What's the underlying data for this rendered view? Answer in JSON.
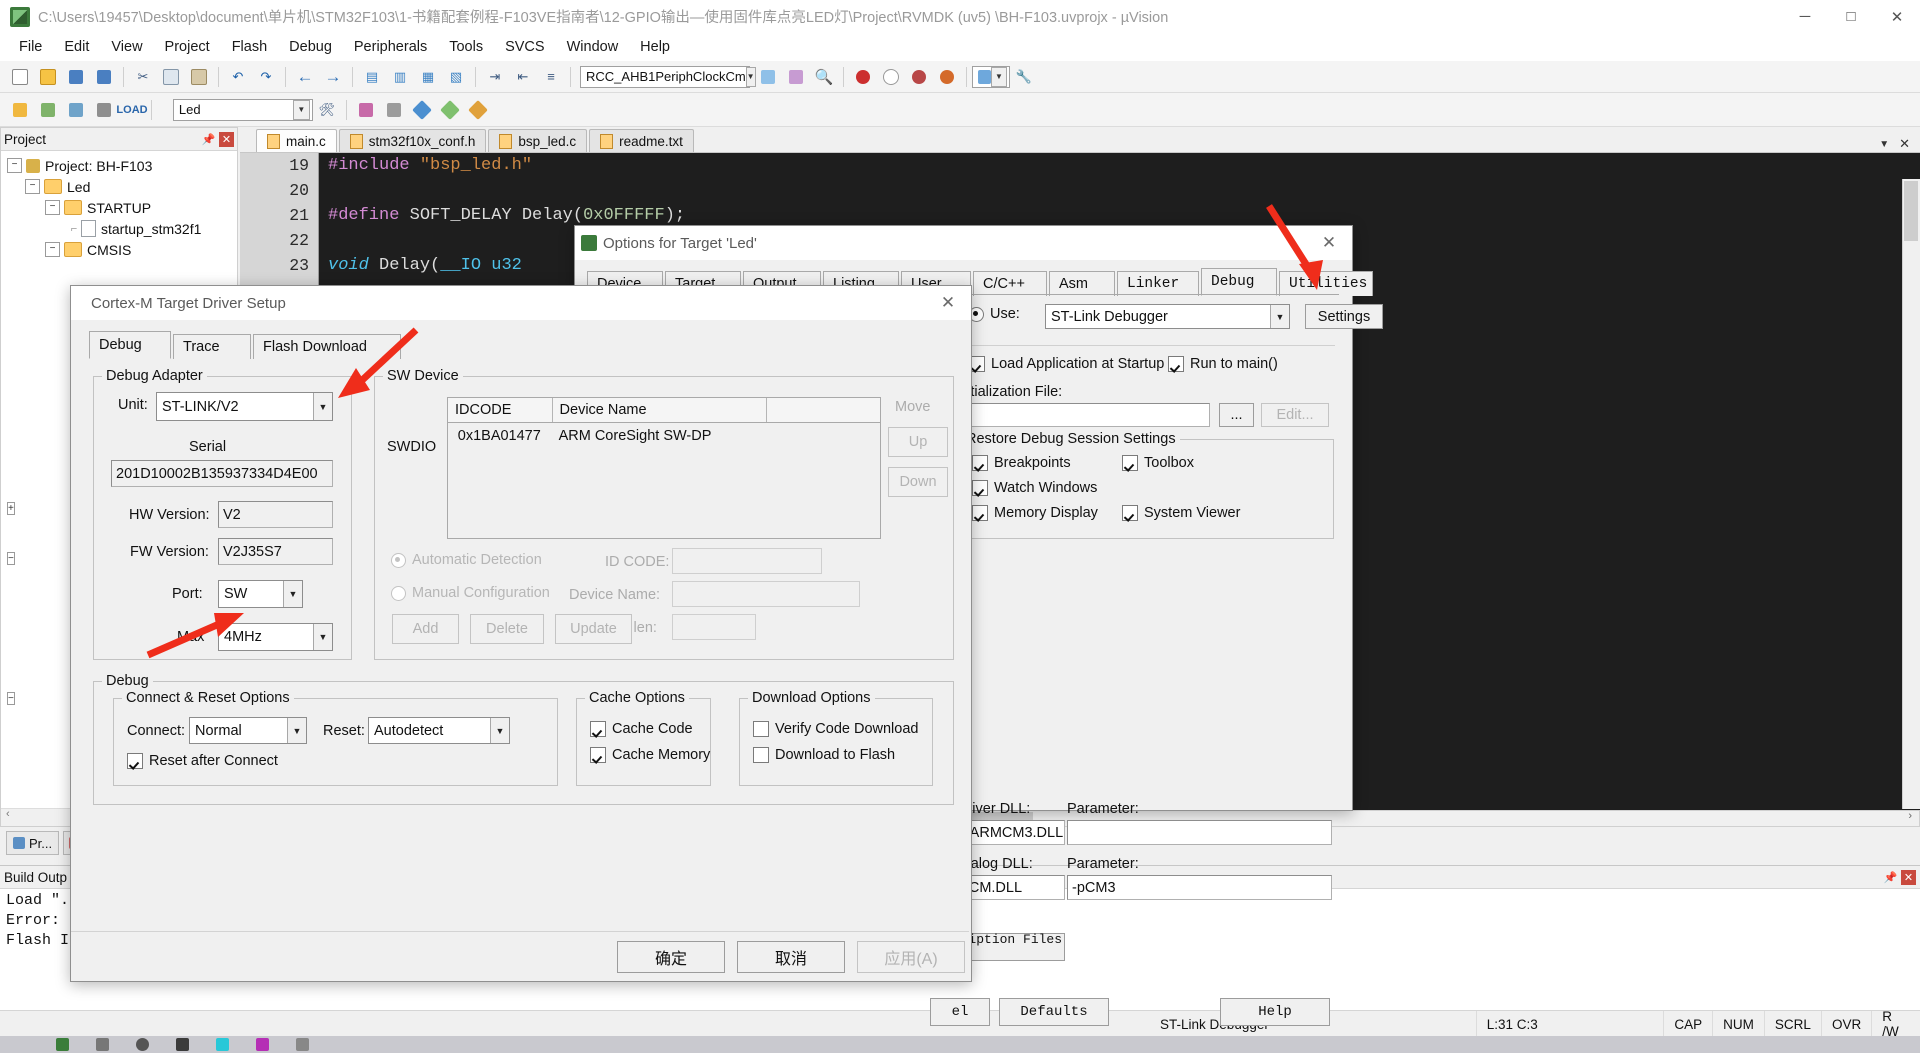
{
  "titlebar": {
    "title": "C:\\Users\\19457\\Desktop\\document\\单片机\\STM32F103\\1-书籍配套例程-F103VE指南者\\12-GPIO输出—使用固件库点亮LED灯\\Project\\RVMDK  (uv5)  \\BH-F103.uvprojx - µVision",
    "minimize": "─",
    "maximize": "□",
    "close": "✕"
  },
  "menubar": {
    "items": [
      "File",
      "Edit",
      "View",
      "Project",
      "Flash",
      "Debug",
      "Peripherals",
      "Tools",
      "SVCS",
      "Window",
      "Help"
    ]
  },
  "toolbar2": {
    "target_value": "Led",
    "peripheral_value": "RCC_AHB1PeriphClockCm"
  },
  "project_panel": {
    "title": "Project",
    "tree": [
      {
        "label": "Project: BH-F103",
        "level": 0,
        "type": "project"
      },
      {
        "label": "Led",
        "level": 1,
        "type": "folder"
      },
      {
        "label": "STARTUP",
        "level": 2,
        "type": "folder"
      },
      {
        "label": "startup_stm32f1",
        "level": 3,
        "type": "file"
      },
      {
        "label": "CMSIS",
        "level": 2,
        "type": "folder"
      }
    ]
  },
  "editor": {
    "tabs": [
      {
        "label": "main.c",
        "active": true
      },
      {
        "label": "stm32f10x_conf.h",
        "active": false
      },
      {
        "label": "bsp_led.c",
        "active": false
      },
      {
        "label": "readme.txt",
        "active": false
      }
    ],
    "lines": [
      {
        "no": "19",
        "text": "#include \"bsp_led.h\""
      },
      {
        "no": "20",
        "text": ""
      },
      {
        "no": "21",
        "text": "#define SOFT_DELAY Delay(0x0FFFFF);"
      },
      {
        "no": "22",
        "text": ""
      },
      {
        "no": "23",
        "text": "void Delay(__IO u32 nCount);"
      }
    ]
  },
  "dock_tabs": [
    {
      "label": "Pr..."
    }
  ],
  "build_output": {
    "title": "Build Outp",
    "lines": [
      "Load \".",
      "Error:",
      "Flash I"
    ]
  },
  "statusbar": {
    "debugger": "ST-Link Debugger",
    "position": "L:31 C:3",
    "indicators": [
      "CAP",
      "NUM",
      "SCRL",
      "OVR",
      "R /W"
    ]
  },
  "options_dialog": {
    "title": "Options for Target 'Led'",
    "close": "✕",
    "tabs": [
      "Device",
      "Target",
      "Output",
      "Listing",
      "User",
      "C/C++",
      "Asm",
      "Linker",
      "Debug",
      "Utilities"
    ],
    "active_tab": "Debug",
    "use_label": "Use:",
    "use_value": "ST-Link Debugger",
    "settings_button": "Settings",
    "load_app_label": "Load Application at Startup",
    "load_app_checked": true,
    "run_to_main_label": "Run to main()",
    "run_to_main_checked": true,
    "init_file_label": "Initialization File:",
    "init_file_value": "",
    "browse_button": "...",
    "edit_button": "Edit...",
    "restore_group": "Restore Debug Session Settings",
    "restore_items": [
      {
        "label": "Breakpoints",
        "checked": true
      },
      {
        "label": "Toolbox",
        "checked": true
      },
      {
        "label": "Watch Windows",
        "checked": true
      },
      {
        "label": "Memory Display",
        "checked": true
      },
      {
        "label": "System Viewer",
        "checked": true
      }
    ],
    "driver_dll_label": "Driver DLL:",
    "driver_dll_value": "SARMCM3.DLL",
    "driver_param_label": "Parameter:",
    "driver_param_value": "",
    "dialog_dll_label": "Dialog DLL:",
    "dialog_dll_value": "TCM.DLL",
    "dialog_param_label": "Parameter:",
    "dialog_param_value": "-pCM3",
    "description_button": "er Description Files ...",
    "cancel_button": "el",
    "defaults_button": "Defaults",
    "help_button": "Help"
  },
  "driver_dialog": {
    "title": "Cortex-M Target Driver Setup",
    "close": "✕",
    "tabs": [
      {
        "label": "Debug",
        "active": true
      },
      {
        "label": "Trace",
        "active": false
      },
      {
        "label": "Flash Download",
        "active": false
      }
    ],
    "adapter": {
      "group": "Debug Adapter",
      "unit_label": "Unit:",
      "unit_value": "ST-LINK/V2",
      "serial_label": "Serial",
      "serial_value": "201D10002B135937334D4E00",
      "hw_label": "HW Version:",
      "hw_value": "V2",
      "fw_label": "FW Version:",
      "fw_value": "V2J35S7",
      "port_label": "Port:",
      "port_value": "SW",
      "max_label": "Max",
      "max_value": "4MHz"
    },
    "sw_device": {
      "group": "SW Device",
      "row_label": "SWDIO",
      "columns": [
        "IDCODE",
        "Device Name",
        ""
      ],
      "rows": [
        [
          "0x1BA01477",
          "ARM CoreSight SW-DP",
          ""
        ]
      ],
      "move_label": "Move",
      "up_button": "Up",
      "down_button": "Down",
      "auto_detect_label": "Automatic Detection",
      "auto_detect_selected": true,
      "manual_config_label": "Manual Configuration",
      "manual_config_selected": false,
      "id_code_label": "ID CODE:",
      "id_code_value": "",
      "device_name_label": "Device Name:",
      "device_name_value": "",
      "ir_len_label": "IR len:",
      "ir_len_value": "",
      "add_button": "Add",
      "delete_button": "Delete",
      "update_button": "Update"
    },
    "debug_group": "Debug",
    "connect_group": "Connect & Reset Options",
    "connect_label": "Connect:",
    "connect_value": "Normal",
    "reset_label": "Reset:",
    "reset_value": "Autodetect",
    "reset_after_connect_label": "Reset after Connect",
    "reset_after_connect_checked": true,
    "cache_group": "Cache Options",
    "cache_items": [
      {
        "label": "Cache Code",
        "checked": true
      },
      {
        "label": "Cache Memory",
        "checked": true
      }
    ],
    "download_group": "Download Options",
    "download_items": [
      {
        "label": "Verify Code Download",
        "checked": false
      },
      {
        "label": "Download to Flash",
        "checked": false
      }
    ],
    "ok_button": "确定",
    "cancel_button": "取消",
    "apply_button": "应用(A)"
  },
  "annotations": {
    "arrow_color": "#ef2d1b",
    "count": 3
  }
}
